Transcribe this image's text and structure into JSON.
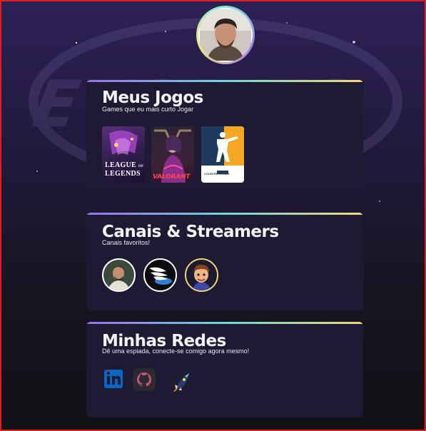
{
  "profile": {
    "avatar_icon": "profile-photo"
  },
  "sections": {
    "games": {
      "title": "Meus Jogos",
      "subtitle": "Games que eu mais curto Jogar",
      "items": [
        {
          "name": "league-of-legends",
          "line1": "LEAGUE",
          "line2": "LEGENDS",
          "of": "OF"
        },
        {
          "name": "valorant",
          "label": "VALORANT"
        },
        {
          "name": "counter-strike",
          "label": "COUNTER STRIKE"
        }
      ]
    },
    "channels": {
      "title": "Canais & Streamers",
      "subtitle": "Canais favoritos!"
    },
    "socials": {
      "title": "Minhas Redes",
      "subtitle": "Dê uma espiada, conecte-se comigo agora mesmo!"
    }
  },
  "colors": {
    "accent_start": "#9c6cf0",
    "accent_mid": "#6ed6d8",
    "accent_end": "#f2d778",
    "card_bg": "#1f1a33"
  }
}
